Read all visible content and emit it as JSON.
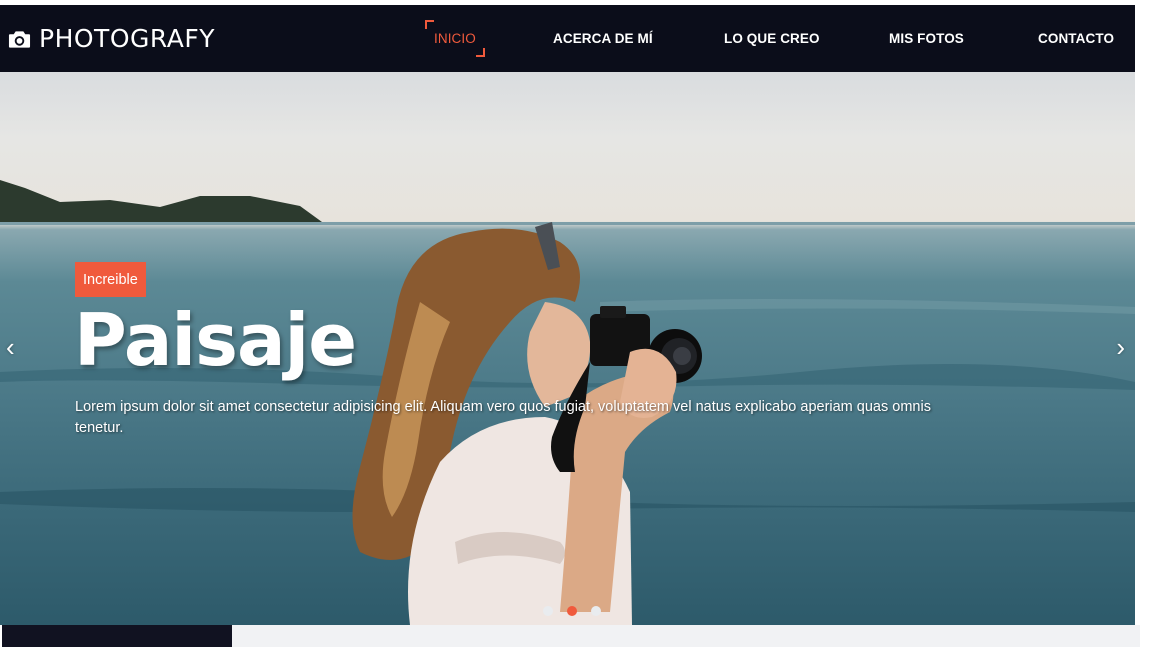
{
  "brand": {
    "name": "PHOTOGRAFY",
    "icon": "camera-icon"
  },
  "nav": {
    "items": [
      {
        "label": "INICIO",
        "active": true
      },
      {
        "label": "ACERCA DE MÍ",
        "active": false
      },
      {
        "label": "LO QUE CREO",
        "active": false
      },
      {
        "label": "MIS FOTOS",
        "active": false
      },
      {
        "label": "CONTACTO",
        "active": false
      }
    ]
  },
  "hero": {
    "badge": "Increible",
    "headline": "Paisaje",
    "lead": "Lorem ipsum dolor sit amet consectetur adipisicing elit. Aliquam vero quos fugiat, voluptatem vel natus explicabo aperiam quas omnis tenetur.",
    "prev_icon": "‹",
    "next_icon": "›",
    "slides": 3,
    "active_slide": 2
  },
  "colors": {
    "accent": "#f05a3c",
    "navbar": "#0b0d1a",
    "text_light": "#ffffff"
  }
}
